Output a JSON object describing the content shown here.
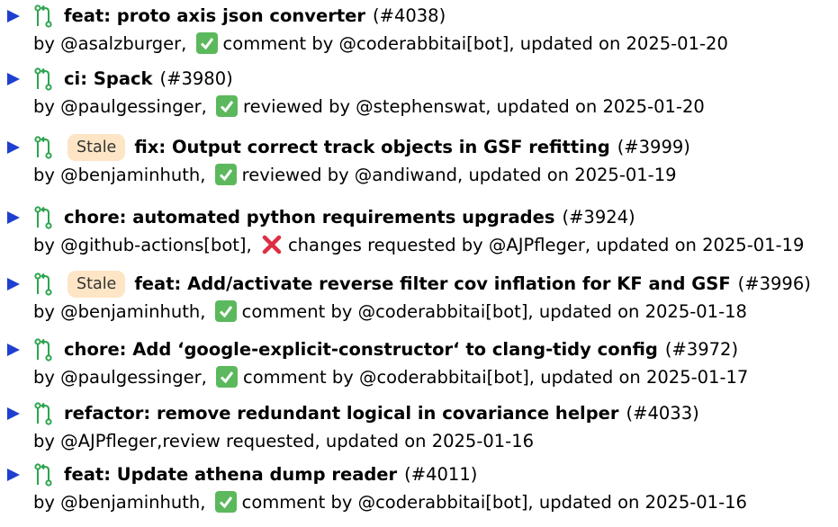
{
  "pull_requests": [
    {
      "title": "feat: proto axis json converter",
      "number": "(#4038)",
      "author": "by @asalzburger,",
      "review": "comment by @coderabbitai[bot], updated on 2025-01-20"
    },
    {
      "title": "ci: Spack",
      "number": "(#3980)",
      "author": "by @paulgessinger,",
      "review": "reviewed by @stephenswat, updated on 2025-01-20"
    },
    {
      "badge": "Stale",
      "title": "fix: Output correct track objects in GSF refitting",
      "number": "(#3999)",
      "author": "by @benjaminhuth,",
      "review": "reviewed by @andiwand, updated on 2025-01-19"
    },
    {
      "title": "chore: automated python requirements upgrades",
      "number": "(#3924)",
      "author": "by @github-actions[bot],",
      "review": "changes requested by @AJPfleger, updated on 2025-01-19"
    },
    {
      "badge": "Stale",
      "title": "feat: Add/activate reverse filter cov inflation for KF and GSF",
      "number": "(#3996)",
      "author": "by @benjaminhuth,",
      "review": "comment by @coderabbitai[bot], updated on 2025-01-18"
    },
    {
      "title": "chore: Add ‘google-explicit-constructor‘ to clang-tidy config",
      "number": "(#3972)",
      "author": "by @paulgessinger,",
      "review": "comment by @coderabbitai[bot], updated on 2025-01-17"
    },
    {
      "title": "refactor: remove redundant logical in covariance helper",
      "number": "(#4033)",
      "author": "by @AJPfleger,review requested, updated on 2025-01-16"
    },
    {
      "title": "feat: Update athena dump reader",
      "number": "(#4011)",
      "author": "by @benjaminhuth,",
      "review": "comment by @coderabbitai[bot], updated on 2025-01-16"
    }
  ]
}
